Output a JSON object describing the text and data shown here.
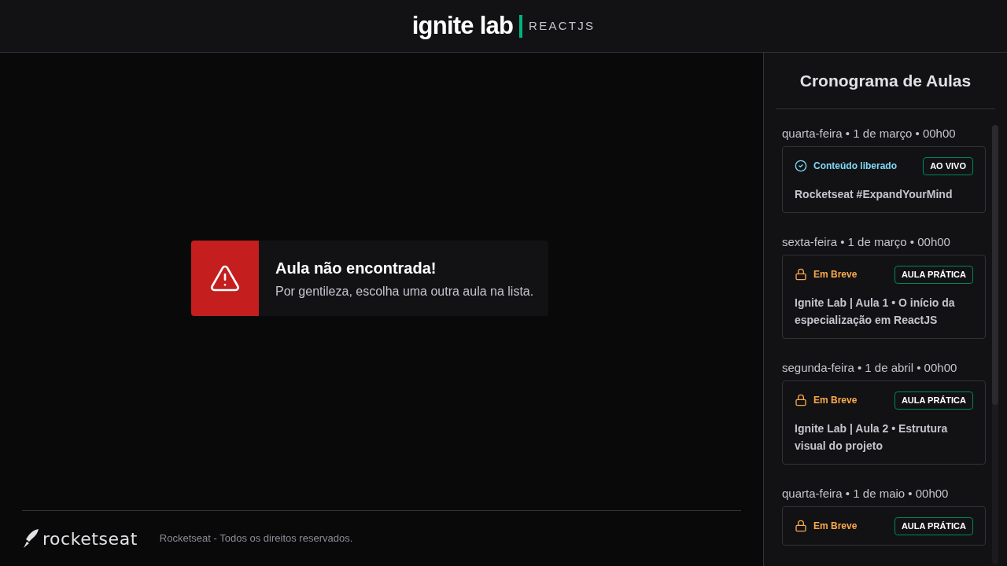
{
  "header": {
    "logo": "ignite lab",
    "subtitle": "REACTJS"
  },
  "alert": {
    "title": "Aula não encontrada!",
    "message": "Por gentileza, escolha uma outra aula na lista."
  },
  "footer": {
    "brand": "rocketseat",
    "copyright": "Rocketseat - Todos os direitos reservados."
  },
  "sidebar": {
    "title": "Cronograma de Aulas",
    "lessons": [
      {
        "date": "quarta-feira • 1 de março • 00h00",
        "kind": "available",
        "status": "Conteúdo liberado",
        "badge": "AO VIVO",
        "title": "Rocketseat #ExpandYourMind"
      },
      {
        "date": "sexta-feira • 1 de março • 00h00",
        "kind": "locked",
        "status": "Em Breve",
        "badge": "AULA PRÁTICA",
        "title": "Ignite Lab | Aula 1 • O início da especialização em ReactJS"
      },
      {
        "date": "segunda-feira • 1 de abril • 00h00",
        "kind": "locked",
        "status": "Em Breve",
        "badge": "AULA PRÁTICA",
        "title": "Ignite Lab | Aula 2 • Estrutura visual do projeto"
      },
      {
        "date": "quarta-feira • 1 de maio • 00h00",
        "kind": "locked",
        "status": "Em Breve",
        "badge": "AULA PRÁTICA"
      }
    ]
  }
}
